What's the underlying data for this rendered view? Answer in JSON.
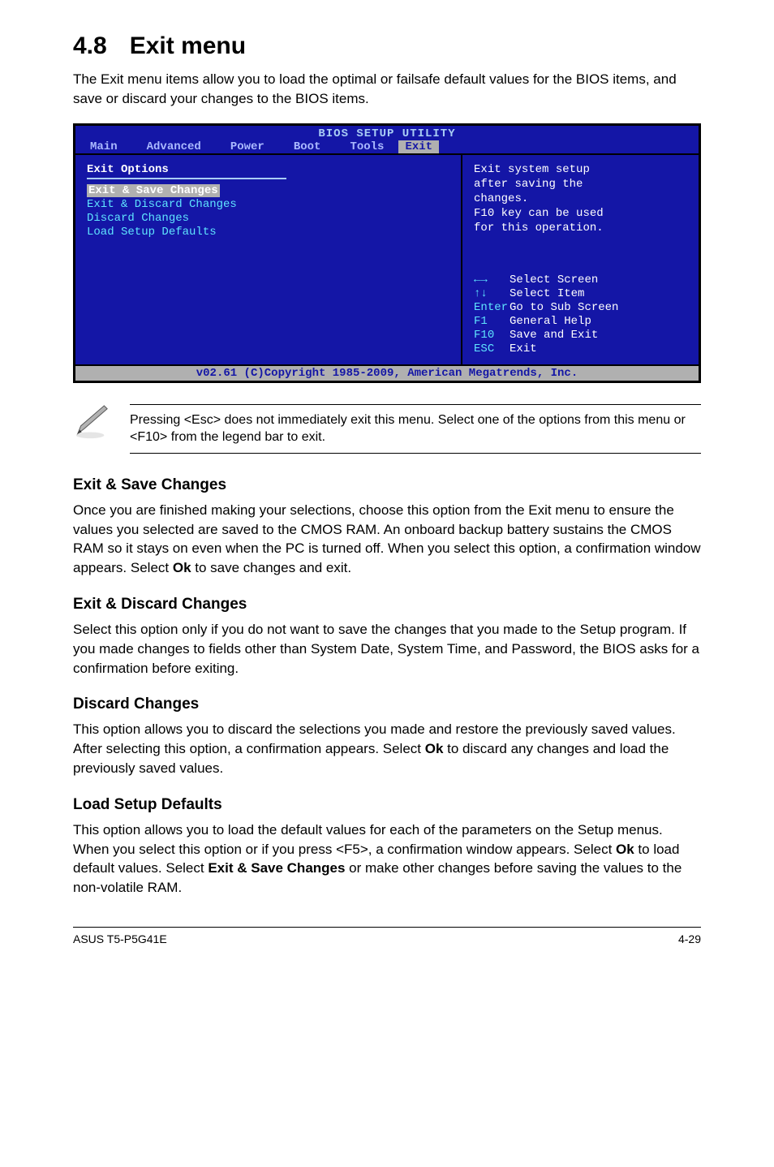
{
  "title_num": "4.8",
  "title_text": "Exit menu",
  "intro": "The Exit menu items allow you to load the optimal or failsafe default values for the BIOS items, and save or discard your changes to the BIOS items.",
  "bios": {
    "header": "BIOS SETUP UTILITY",
    "tabs": [
      "Main",
      "Advanced",
      "Power",
      "Boot",
      "Tools",
      "Exit"
    ],
    "active_tab": "Exit",
    "left": {
      "heading": "Exit Options",
      "items": [
        "Exit & Save Changes",
        "Exit & Discard Changes",
        "Discard Changes",
        "",
        "Load Setup Defaults"
      ],
      "selected_index": 0
    },
    "right": {
      "help_lines": [
        "Exit system setup",
        "after saving the",
        "changes.",
        "",
        "F10 key can be used",
        "for this operation."
      ],
      "keys": [
        {
          "k": "←→",
          "d": "Select Screen"
        },
        {
          "k": "↑↓",
          "d": "Select Item"
        },
        {
          "k": "Enter",
          "d": "Go to Sub Screen"
        },
        {
          "k": "F1",
          "d": "General Help"
        },
        {
          "k": "F10",
          "d": "Save and Exit"
        },
        {
          "k": "ESC",
          "d": "Exit"
        }
      ]
    },
    "footer": "v02.61 (C)Copyright 1985-2009, American Megatrends, Inc."
  },
  "note": "Pressing <Esc> does not immediately exit this menu. Select one of the options from this menu or <F10> from the legend bar to exit.",
  "sections": {
    "s1": {
      "h": "Exit & Save Changes",
      "p_before": "Once you are finished making your selections, choose this option from the Exit menu to ensure the values you selected are saved to the CMOS RAM. An onboard backup battery sustains the CMOS RAM so it stays on even when the PC is turned off. When you select this option, a confirmation window appears. Select ",
      "p_bold": "Ok",
      "p_after": " to save changes and exit."
    },
    "s2": {
      "h": "Exit & Discard Changes",
      "p": "Select this option only if you do not want to save the changes that you  made to the Setup program. If you made changes to fields other than System Date, System Time, and Password, the BIOS asks for a confirmation before exiting."
    },
    "s3": {
      "h": "Discard Changes",
      "p_before": "This option allows you to discard the selections you made and restore the previously saved values. After selecting this option, a confirmation appears. Select ",
      "p_bold": "Ok",
      "p_after": " to discard any changes and load the previously saved values."
    },
    "s4": {
      "h": "Load Setup Defaults",
      "p_before": "This option allows you to load the default values for each of the parameters on the Setup menus. When you select this option or if you press <F5>, a confirmation window appears. Select ",
      "p_bold1": "Ok",
      "p_mid": " to load default values. Select ",
      "p_bold2": "Exit & Save Changes",
      "p_after": " or make other changes before saving the values to the non-volatile RAM."
    }
  },
  "footer_left": "ASUS T5-P5G41E",
  "footer_right": "4-29"
}
